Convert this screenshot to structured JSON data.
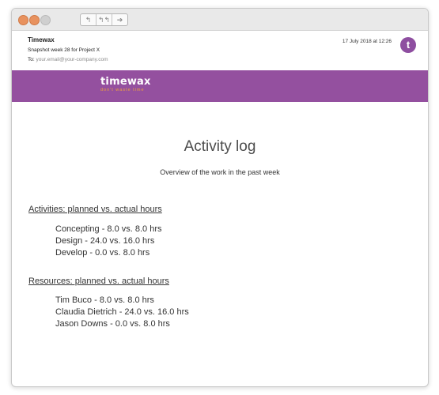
{
  "window": {
    "nav_buttons": [
      "back-icon",
      "reply-all-icon",
      "forward-icon"
    ],
    "nav_glyphs": [
      "↰",
      "↰↰",
      "➔"
    ]
  },
  "email": {
    "sender": "Timewax",
    "subject": "Snapshot week 28 for Project X",
    "to_label": "To:",
    "to_address": "your.email@your-company.com",
    "date": "17 July 2018 at 12:26",
    "avatar_letter": "t"
  },
  "banner": {
    "logo_text": "timewax",
    "tagline": "don't waste time",
    "background_color": "#94509f",
    "tagline_color": "#f2a33a"
  },
  "report": {
    "title": "Activity log",
    "subtitle": "Overview of the work in the past week",
    "activities": {
      "heading": "Activities: planned vs. actual hours",
      "items": [
        "Concepting  -  8.0 vs. 8.0 hrs",
        "Design  -  24.0 vs. 16.0 hrs",
        "Develop  -  0.0 vs. 8.0 hrs"
      ]
    },
    "resources": {
      "heading": "Resources: planned vs. actual hours",
      "items": [
        "Tim Buco  -  8.0 vs. 8.0 hrs",
        "Claudia Dietrich  -  24.0 vs. 16.0 hrs",
        "Jason Downs  -  0.0 vs. 8.0 hrs"
      ]
    }
  }
}
